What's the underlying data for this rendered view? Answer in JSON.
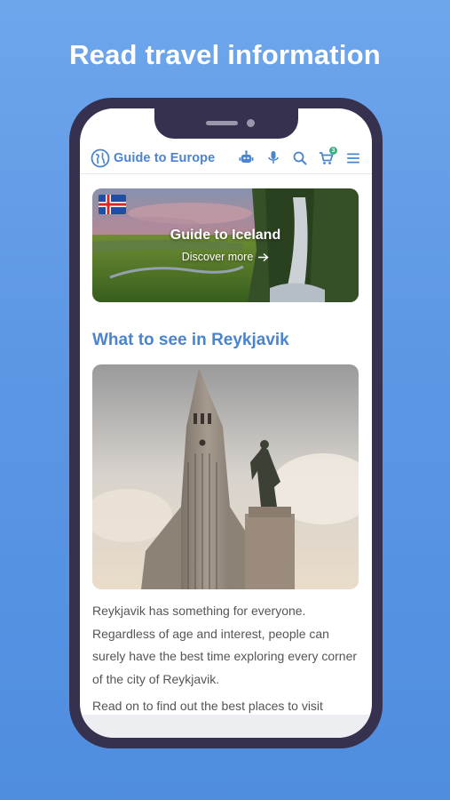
{
  "promo": {
    "headline": "Read travel information"
  },
  "app": {
    "name": "Guide to Europe",
    "cart_count": "3"
  },
  "hero": {
    "title": "Guide to Iceland",
    "link": "Discover more"
  },
  "section": {
    "title": "What to see in Reykjavik"
  },
  "article": {
    "paragraph_1": "Reykjavik has something for everyone. Regardless of age and interest, people can surely have the best time exploring every corner of the city of Reykjavik.",
    "paragraph_2": "Read on to find out the best places to visit"
  },
  "colors": {
    "accent": "#4a83cf",
    "background": "#5c97e4",
    "phone_frame": "#35314f",
    "badge": "#36b37e"
  },
  "icons": [
    "globe-logo-icon",
    "robot-icon",
    "microphone-icon",
    "search-icon",
    "cart-icon",
    "menu-icon",
    "iceland-flag-icon",
    "arrow-right-icon"
  ]
}
